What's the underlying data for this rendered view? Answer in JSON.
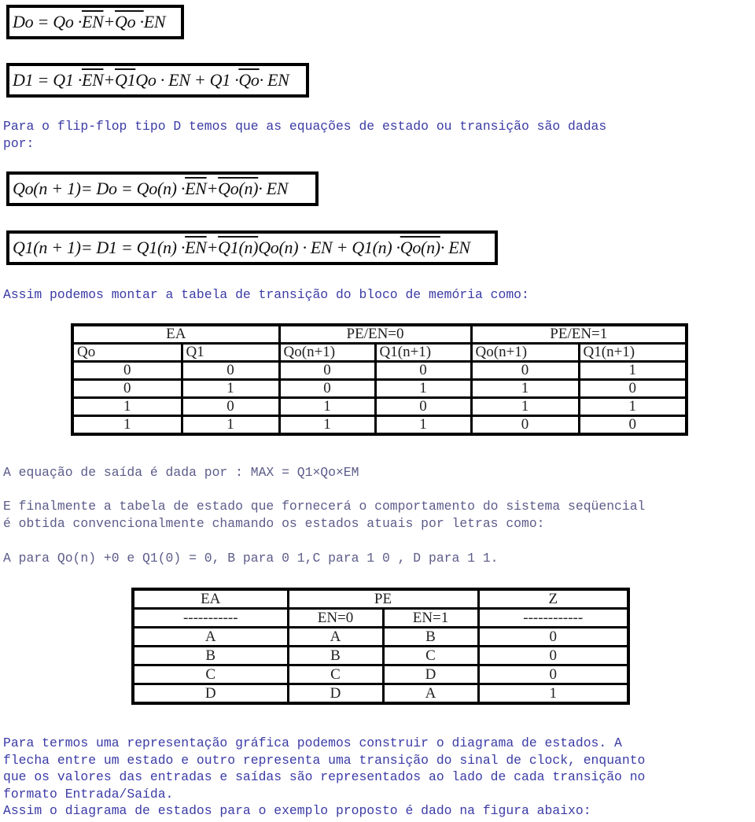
{
  "equations": {
    "d0": {
      "lhs": "Do",
      "parts": [
        "= Qo · ",
        "EN",
        " + ",
        "Qo ·",
        "EN"
      ]
    },
    "d1": {
      "lhs": "D1",
      "parts": [
        "= Q1 · ",
        "EN",
        " + ",
        "Q1",
        " Qo · EN + Q1 · ",
        "Qo",
        " · EN"
      ]
    },
    "q0n1": {
      "lhs": "Qo(n + 1)",
      "parts": [
        " = Do = Qo(n) · ",
        "EN",
        " + ",
        "Qo(n)",
        " · EN"
      ]
    },
    "q1n1": {
      "lhs": "Q1(n + 1)",
      "parts": [
        " = D1 = Q1(n) · ",
        "EN",
        " + ",
        "Q1(n)",
        " Qo(n) · EN + Q1(n) · ",
        "Qo(n)",
        " · EN"
      ]
    }
  },
  "paragraphs": {
    "p1": "Para o flip-flop tipo D temos que as equações de estado ou transição são dadas\npor:",
    "p2": "Assim podemos montar a tabela de transição do bloco de memória como:",
    "p3": "A equação de saída é dada por : MAX = Q1×Qo×EM",
    "p4": "E finalmente a tabela de estado que fornecerá o comportamento do sistema seqüencial\né obtida convencionalmente chamando os estados atuais por letras como:",
    "p5": "A para Qo(n) +0 e Q1(0) = 0, B para 0 1,C para 1 0 , D para 1 1.",
    "p6": "Para termos uma representação gráfica podemos construir o diagrama de estados. A\nflecha entre um estado e outro representa uma transição do sinal de clock, enquanto\nque os valores das entradas e saídas são representados ao lado de cada transição no\nformato Entrada/Saída.\nAssim o diagrama de estados para o exemplo proposto é dado na figura abaixo:"
  },
  "transition_table": {
    "group_headers": [
      "EA",
      "PE/EN=0",
      "PE/EN=1"
    ],
    "sub_headers": [
      "Qo",
      "Q1",
      "Qo(n+1)",
      "Q1(n+1)",
      "Qo(n+1)",
      "Q1(n+1)"
    ],
    "rows": [
      [
        "0",
        "0",
        "0",
        "0",
        "0",
        "1"
      ],
      [
        "0",
        "1",
        "0",
        "1",
        "1",
        "0"
      ],
      [
        "1",
        "0",
        "1",
        "0",
        "1",
        "1"
      ],
      [
        "1",
        "1",
        "1",
        "1",
        "0",
        "0"
      ]
    ]
  },
  "state_table": {
    "group_headers": [
      "EA",
      "PE",
      "Z"
    ],
    "sub_headers": [
      "-----------",
      "EN=0",
      "EN=1",
      "------------"
    ],
    "rows": [
      [
        "A",
        "A",
        "B",
        "0"
      ],
      [
        "B",
        "B",
        "C",
        "0"
      ],
      [
        "C",
        "C",
        "D",
        "0"
      ],
      [
        "D",
        "D",
        "A",
        "1"
      ]
    ]
  },
  "colors": {
    "text_blue": "#3b3ba6",
    "text_gray_blue": "#5c5c8a",
    "border": "#000000"
  }
}
